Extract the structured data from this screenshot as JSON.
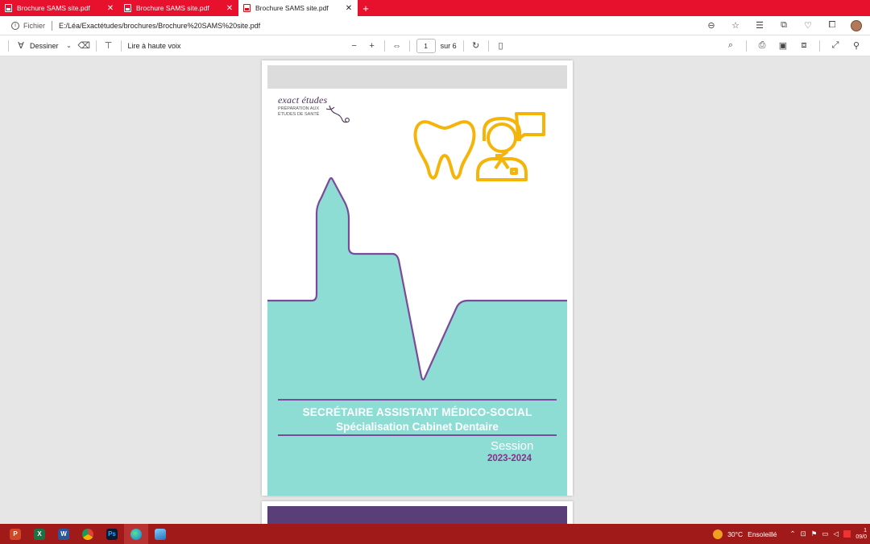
{
  "browser": {
    "tabs": [
      {
        "title": "Brochure SAMS site.pdf",
        "close": "✕",
        "active": false
      },
      {
        "title": "Brochure SAMS site.pdf",
        "close": "✕",
        "active": false
      },
      {
        "title": "Brochure SAMS site.pdf",
        "close": "✕",
        "active": true
      }
    ],
    "new_tab": "+",
    "address": {
      "label": "Fichier",
      "url": "E:/Léa/Exactétudes/brochures/Brochure%20SAMS%20site.pdf"
    }
  },
  "pdf_toolbar": {
    "draw_label": "Dessiner",
    "read_aloud_label": "Lire à haute voix",
    "zoom_out": "−",
    "zoom_in": "+",
    "page_current": "1",
    "page_total": "sur 6"
  },
  "document": {
    "logo_title": "exact études",
    "logo_subtitle": "PRÉPARATION AUX ÉTUDES DE SANTÉ",
    "heading_line1": "SECRÉTAIRE ASSISTANT MÉDICO-SOCIAL",
    "heading_line2": "Spécialisation Cabinet Dentaire",
    "session_label": "Session",
    "session_years": "2023-2024",
    "colors": {
      "teal": "#8eddd4",
      "purple": "#7b4a9a",
      "icon_yellow": "#f5b40a",
      "top_band": "#dcdcdc",
      "second_page_band": "#5a3e78"
    }
  },
  "taskbar": {
    "apps": [
      {
        "name": "powerpoint",
        "letter": "P",
        "color": "#d24726"
      },
      {
        "name": "excel",
        "letter": "X",
        "color": "#1e7145"
      },
      {
        "name": "word",
        "letter": "W",
        "color": "#2b579a"
      },
      {
        "name": "chrome",
        "letter": "",
        "color": "#e8b52f"
      },
      {
        "name": "photoshop",
        "letter": "Ps",
        "color": "#0b1a33"
      },
      {
        "name": "edge",
        "letter": "",
        "color": "#1f9bd7"
      },
      {
        "name": "photos",
        "letter": "",
        "color": "#3a8fd1"
      }
    ],
    "weather_temp": "30°C",
    "weather_desc": "Ensoleillé",
    "clock_time": "1",
    "clock_date": "09/0"
  }
}
